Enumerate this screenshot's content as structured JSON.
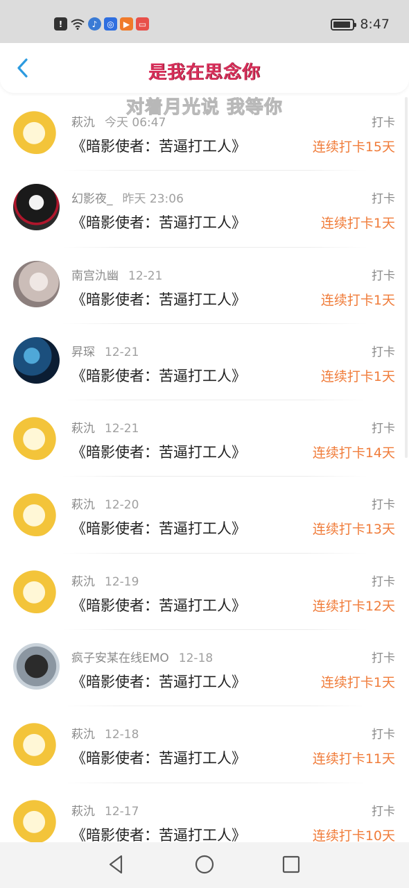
{
  "status_bar": {
    "time": "8:47",
    "icons": [
      "alert-icon",
      "wifi-icon",
      "music-app-icon",
      "bulb-app-icon",
      "video-app-icon",
      "red-app-icon"
    ]
  },
  "header": {
    "title": "是我在思念你",
    "overlay_text": "对着月光说 我等你",
    "title_color": "#d82f5a"
  },
  "colors": {
    "back_arrow": "#2d9be0",
    "streak": "#f07c3a",
    "meta": "#8a8a8a"
  },
  "items": [
    {
      "user": "萩氿",
      "time": "今天 06:47",
      "action": "打卡",
      "book": "《暗影使者：苦逼打工人》",
      "streak": "连续打卡15天",
      "avatar": "yellow-hair-avatar"
    },
    {
      "user": "幻影夜_",
      "time": "昨天 23:06",
      "action": "打卡",
      "book": "《暗影使者：苦逼打工人》",
      "streak": "连续打卡1天",
      "avatar": "dark-anime-avatar"
    },
    {
      "user": "南宫氿幽",
      "time": "12-21",
      "action": "打卡",
      "book": "《暗影使者：苦逼打工人》",
      "streak": "连续打卡1天",
      "avatar": "white-hair-girl-avatar"
    },
    {
      "user": "昇琛",
      "time": "12-21",
      "action": "打卡",
      "book": "《暗影使者：苦逼打工人》",
      "streak": "连续打卡1天",
      "avatar": "night-sky-avatar"
    },
    {
      "user": "萩氿",
      "time": "12-21",
      "action": "打卡",
      "book": "《暗影使者：苦逼打工人》",
      "streak": "连续打卡14天",
      "avatar": "yellow-hair-avatar"
    },
    {
      "user": "萩氿",
      "time": "12-20",
      "action": "打卡",
      "book": "《暗影使者：苦逼打工人》",
      "streak": "连续打卡13天",
      "avatar": "yellow-hair-avatar"
    },
    {
      "user": "萩氿",
      "time": "12-19",
      "action": "打卡",
      "book": "《暗影使者：苦逼打工人》",
      "streak": "连续打卡12天",
      "avatar": "yellow-hair-avatar"
    },
    {
      "user": "疯子安某在线EMO",
      "time": "12-18",
      "action": "打卡",
      "book": "《暗影使者：苦逼打工人》",
      "streak": "连续打卡1天",
      "avatar": "grey-anime-avatar"
    },
    {
      "user": "萩氿",
      "time": "12-18",
      "action": "打卡",
      "book": "《暗影使者：苦逼打工人》",
      "streak": "连续打卡11天",
      "avatar": "yellow-hair-avatar"
    },
    {
      "user": "萩氿",
      "time": "12-17",
      "action": "打卡",
      "book": "《暗影使者：苦逼打工人》",
      "streak": "连续打卡10天",
      "avatar": "yellow-hair-avatar"
    }
  ],
  "nav_bar": {
    "buttons": [
      "back-triangle-icon",
      "home-circle-icon",
      "recents-square-icon"
    ]
  }
}
